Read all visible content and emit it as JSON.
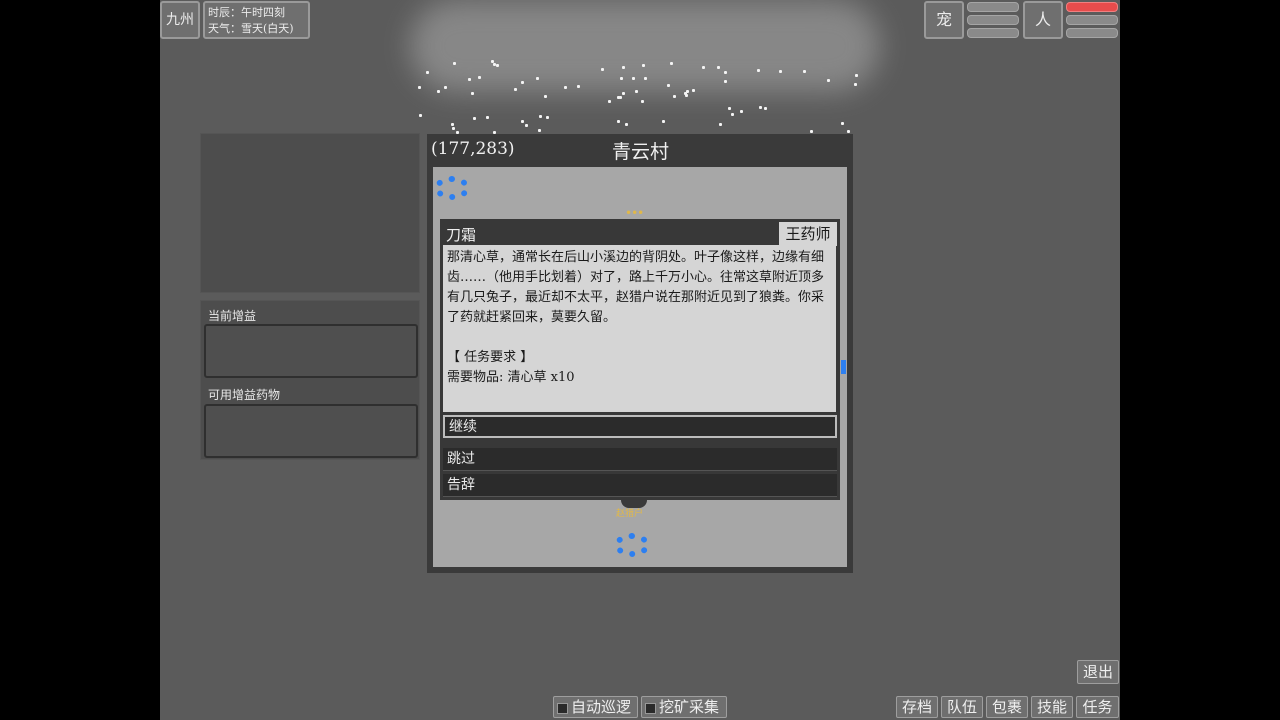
{
  "hud": {
    "region": "九州",
    "time_label": "时辰：午时四刻",
    "weather_label": "天气：雪天(白天)",
    "pet_button": "宠",
    "person_button": "人",
    "colors": {
      "health": "#e74c4c",
      "ring": "#2d7ff0"
    }
  },
  "left_panel": {
    "buffs_title": "当前增益",
    "potions_title": "可用增益药物"
  },
  "map": {
    "coords": "(177,283)",
    "name": "青云村",
    "npc_label": "赵猎户"
  },
  "dialog": {
    "speaker_left": "刀霜",
    "speaker_right": "王药师",
    "body": "那清心草，通常长在后山小溪边的背阴处。叶子像这样，边缘有细齿……（他用手比划着）对了，路上千万小心。往常这草附近顶多有几只兔子，最近却不太平，赵猎户说在那附近见到了狼粪。你采了药就赶紧回来，莫要久留。\n\n【 任务要求 】\n需要物品: 清心草 x10",
    "options": [
      {
        "label": "继续"
      },
      {
        "label": "跳过"
      },
      {
        "label": "告辞"
      }
    ]
  },
  "bottom": {
    "exit": "退出",
    "auto_patrol": "自动巡逻",
    "mining": "挖矿采集",
    "menu": [
      "存档",
      "队伍",
      "包裹",
      "技能",
      "任务"
    ]
  }
}
